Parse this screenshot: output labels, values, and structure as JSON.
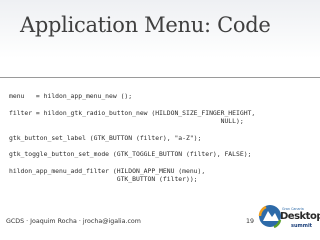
{
  "slide": {
    "title": "Application Menu: Code",
    "code_lines": [
      "menu   = hildon_app_menu_new ();",
      "",
      "filter = hildon_gtk_radio_button_new (HILDON_SIZE_FINGER_HEIGHT,",
      "                                                       NULL);",
      "",
      "gtk_button_set_label (GTK_BUTTON (filter), \"a-Z\");",
      "",
      "gtk_toggle_button_set_mode (GTK_TOGGLE_BUTTON (filter), FALSE);",
      "",
      "hildon_app_menu_add_filter (HILDON_APP_MENU (menu),",
      "                            GTK_BUTTON (filter));"
    ]
  },
  "footer": {
    "text": "GCDS · Joaquim Rocha · jrocha@igalia.com",
    "page_number": "19"
  },
  "logo": {
    "small_text": "Gran Canaria",
    "big_text": "Desktop",
    "sub_text": "summit"
  },
  "colors": {
    "title": "#3f3f3f",
    "divider": "#9a9a9a",
    "logo_blue": "#2d6aa8",
    "logo_orange": "#f0a020",
    "logo_green": "#5aa02c"
  }
}
